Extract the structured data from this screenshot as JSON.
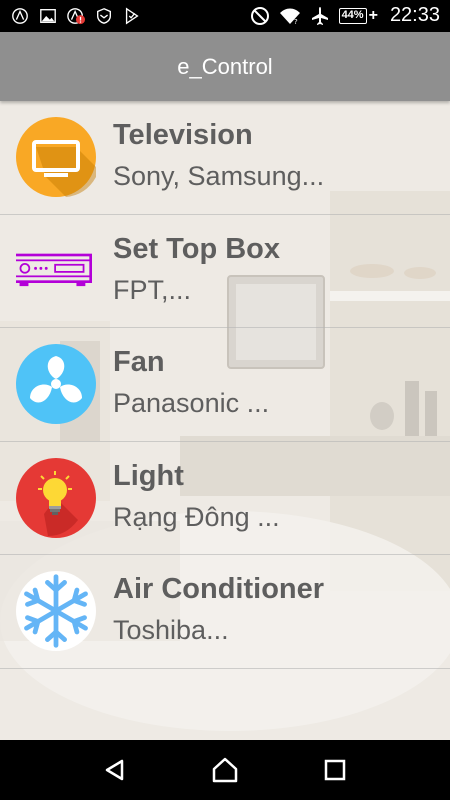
{
  "status_bar": {
    "left_icons": [
      "app-logo-icon",
      "image-icon",
      "alert-app-icon",
      "shield-icon",
      "check-flag-icon"
    ],
    "right_icons": [
      "do-not-disturb-icon",
      "wifi-icon",
      "airplane-icon"
    ],
    "battery_percent": "44%",
    "charging": "+",
    "time": "22:33"
  },
  "app_bar": {
    "title": "e_Control"
  },
  "devices": [
    {
      "name": "Television",
      "brands": "Sony, Samsung...",
      "icon": "television-icon"
    },
    {
      "name": "Set Top Box",
      "brands": "FPT,...",
      "icon": "set-top-box-icon"
    },
    {
      "name": "Fan",
      "brands": "Panasonic ...",
      "icon": "fan-icon"
    },
    {
      "name": "Light",
      "brands": "Rạng Đông ...",
      "icon": "light-bulb-icon"
    },
    {
      "name": "Air Conditioner",
      "brands": "Toshiba...",
      "icon": "snowflake-icon"
    }
  ],
  "nav_bar": {
    "icons": [
      "back-icon",
      "home-icon",
      "recents-icon"
    ]
  },
  "colors": {
    "app_bar": "#8f8f8f",
    "tv_icon_bg": "#f9a825",
    "set_top_box": "#b300d8",
    "fan_icon_bg": "#4fc3f7",
    "light_icon_bg": "#e53935",
    "snowflake": "#64b5f6",
    "text": "#5e5e5e"
  }
}
